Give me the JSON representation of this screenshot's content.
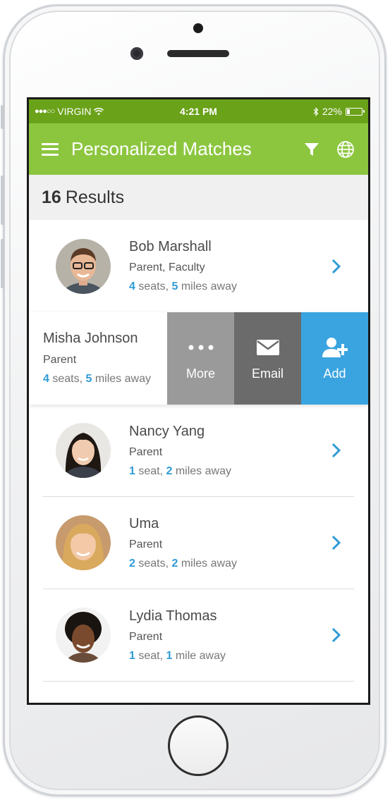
{
  "status_bar": {
    "carrier": "VIRGIN",
    "time": "4:21 PM",
    "battery": "22%",
    "battery_level": 0.22
  },
  "app_bar": {
    "title": "Personalized Matches",
    "icons": [
      "menu-icon",
      "filter-icon",
      "globe-icon"
    ]
  },
  "results": {
    "count": "16",
    "label": "Results"
  },
  "matches": [
    {
      "name": "Bob Marshall",
      "role": "Parent, Faculty",
      "seats": "4",
      "seats_label": " seats, ",
      "miles": "5",
      "miles_label": " miles away"
    },
    {
      "name": "Misha Johnson",
      "role": "Parent",
      "seats": "4",
      "seats_label": " seats, ",
      "miles": "5",
      "miles_label": " miles away"
    },
    {
      "name": "Nancy Yang",
      "role": "Parent",
      "seats": "1",
      "seats_label": " seat, ",
      "miles": "2",
      "miles_label": " miles away"
    },
    {
      "name": "Uma",
      "role": "Parent",
      "seats": "2",
      "seats_label": " seats, ",
      "miles": "2",
      "miles_label": " miles away"
    },
    {
      "name": "Lydia Thomas",
      "role": "Parent",
      "seats": "1",
      "seats_label": " seat, ",
      "miles": "1",
      "miles_label": " mile away"
    }
  ],
  "swipe_actions": {
    "more": "More",
    "email": "Email",
    "add": "Add"
  },
  "colors": {
    "status_bar": "#6aa219",
    "app_bar": "#8cc63f",
    "accent_blue": "#2f9bd6",
    "more_action": "#9a9a9a",
    "email_action": "#6b6b6b",
    "add_action": "#3aa4e0"
  }
}
